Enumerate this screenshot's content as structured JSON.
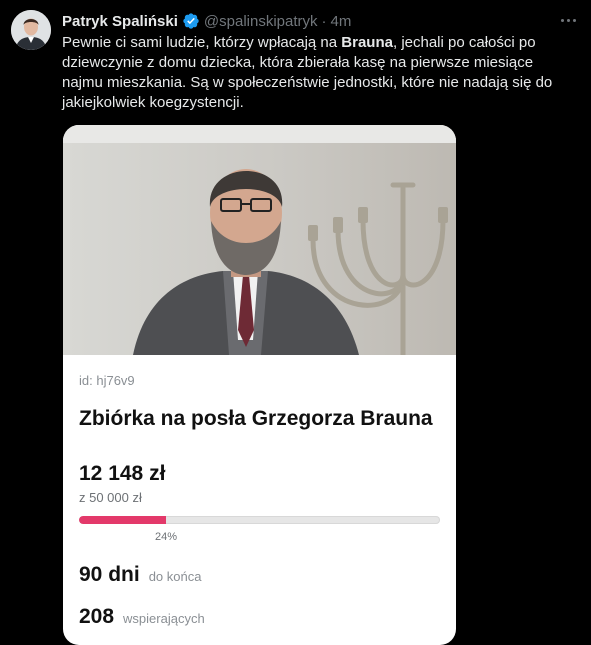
{
  "tweet": {
    "author_name": "Patryk Spaliński",
    "handle": "@spalinskipatryk",
    "separator": "·",
    "time": "4m",
    "verified_icon": "verified-badge-icon",
    "more_icon": "more-options-icon",
    "text_before": "Pewnie ci sami ludzie, którzy wpłacają na ",
    "text_bold": "Brauna",
    "text_after": ", jechali po całości po dziewczynie z domu dziecka, która zbierała kasę na pierwsze miesiące najmu mieszkania. Są w społeczeństwie jednostki, które nie nadają się do jakiejkolwiek koegzystencji."
  },
  "card": {
    "id_label": "id: hj76v9",
    "title": "Zbiórka na posła Grzegorza Brauna",
    "amount": "12 148 zł",
    "goal": "z 50 000 zł",
    "progress_percent": 24,
    "progress_label": "24%",
    "days_value": "90 dni",
    "days_label": "do końca",
    "supporters_value": "208",
    "supporters_label": "wspierających"
  },
  "colors": {
    "background": "#000000",
    "text": "#e7e9ea",
    "muted": "#71767b",
    "verified": "#1d9bf0",
    "progress_fill": "#e3396a"
  }
}
